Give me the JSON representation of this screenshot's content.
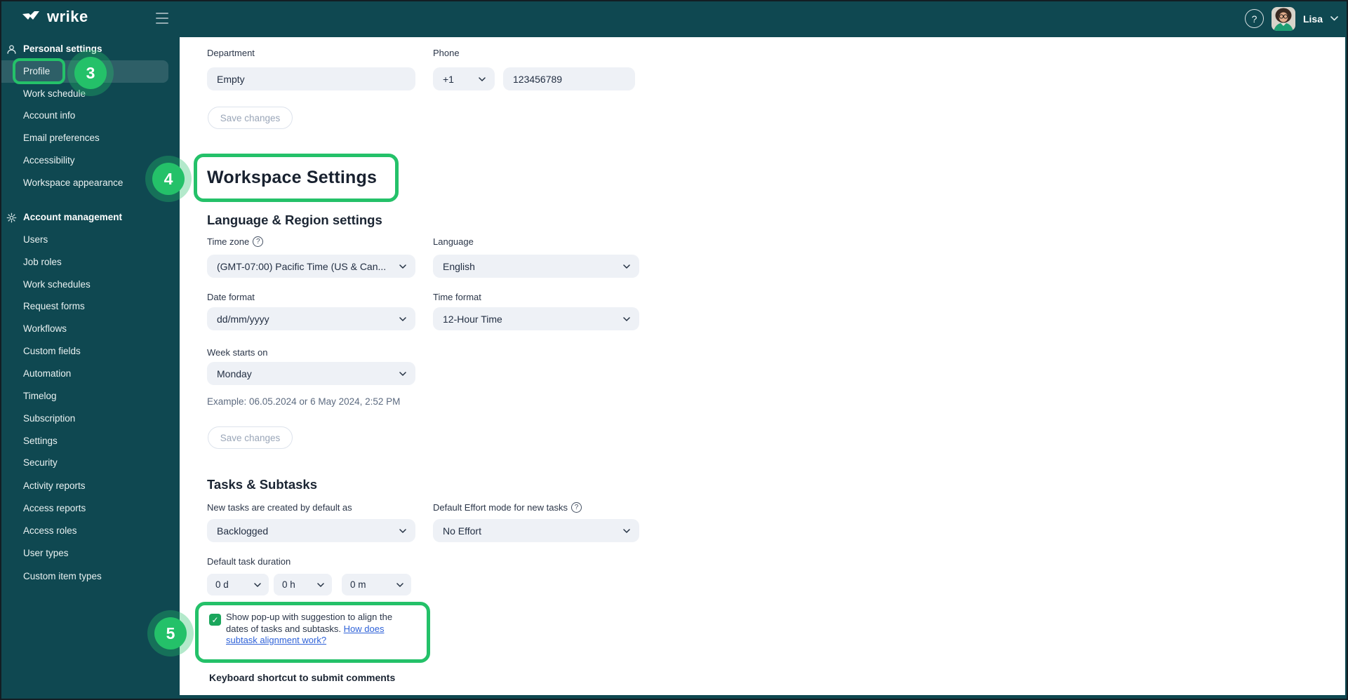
{
  "topbar": {
    "logo": "wrike",
    "help_label": "?",
    "user": {
      "name": "Lisa"
    }
  },
  "sidebar": {
    "section1": {
      "label": "Personal settings",
      "items": [
        "Profile",
        "Work schedule",
        "Account info",
        "Email preferences",
        "Accessibility",
        "Workspace appearance"
      ]
    },
    "section2": {
      "label": "Account management",
      "items": [
        "Users",
        "Job roles",
        "Work schedules",
        "Request forms",
        "Workflows",
        "Custom fields",
        "Automation",
        "Timelog",
        "Subscription",
        "Settings",
        "Security",
        "Activity reports",
        "Access reports",
        "Access roles",
        "User types",
        "Custom item types"
      ]
    },
    "selected_item": "Profile"
  },
  "profile": {
    "department_label": "Department",
    "department_value": "Empty",
    "phone_label": "Phone",
    "phone_code": "+1",
    "phone_number": "123456789",
    "save_button": "Save changes"
  },
  "workspace_settings": {
    "title": "Workspace Settings",
    "language_region": {
      "heading": "Language & Region settings",
      "timezone_label": "Time zone",
      "timezone_value": "(GMT-07:00) Pacific Time (US & Can...",
      "language_label": "Language",
      "language_value": "English",
      "date_format_label": "Date format",
      "date_format_value": "dd/mm/yyyy",
      "time_format_label": "Time format",
      "time_format_value": "12-Hour Time",
      "week_starts_label": "Week starts on",
      "week_starts_value": "Monday",
      "example_text": "Example: 06.05.2024 or 6 May 2024, 2:52 PM",
      "save_button": "Save changes"
    },
    "tasks_subtasks": {
      "heading": "Tasks & Subtasks",
      "new_tasks_label": "New tasks are created by default as",
      "new_tasks_value": "Backlogged",
      "effort_label": "Default Effort mode for new tasks",
      "effort_value": "No Effort",
      "duration_label": "Default task duration",
      "duration_days": "0 d",
      "duration_hours": "0 h",
      "duration_minutes": "0 m",
      "popup_checkbox_text": "Show pop-up with suggestion to align the dates of tasks and subtasks. ",
      "popup_link": "How does subtask alignment work?",
      "keyboard_label": "Keyboard shortcut to submit comments"
    }
  },
  "annotations": {
    "step3": "3",
    "step4": "4",
    "step5": "5"
  },
  "colors": {
    "brand_teal": "#0f4851",
    "annotation_green": "#24c169",
    "link_blue": "#2f62d8",
    "checkbox_green": "#1ba65c",
    "field_bg": "#eef1f6"
  }
}
